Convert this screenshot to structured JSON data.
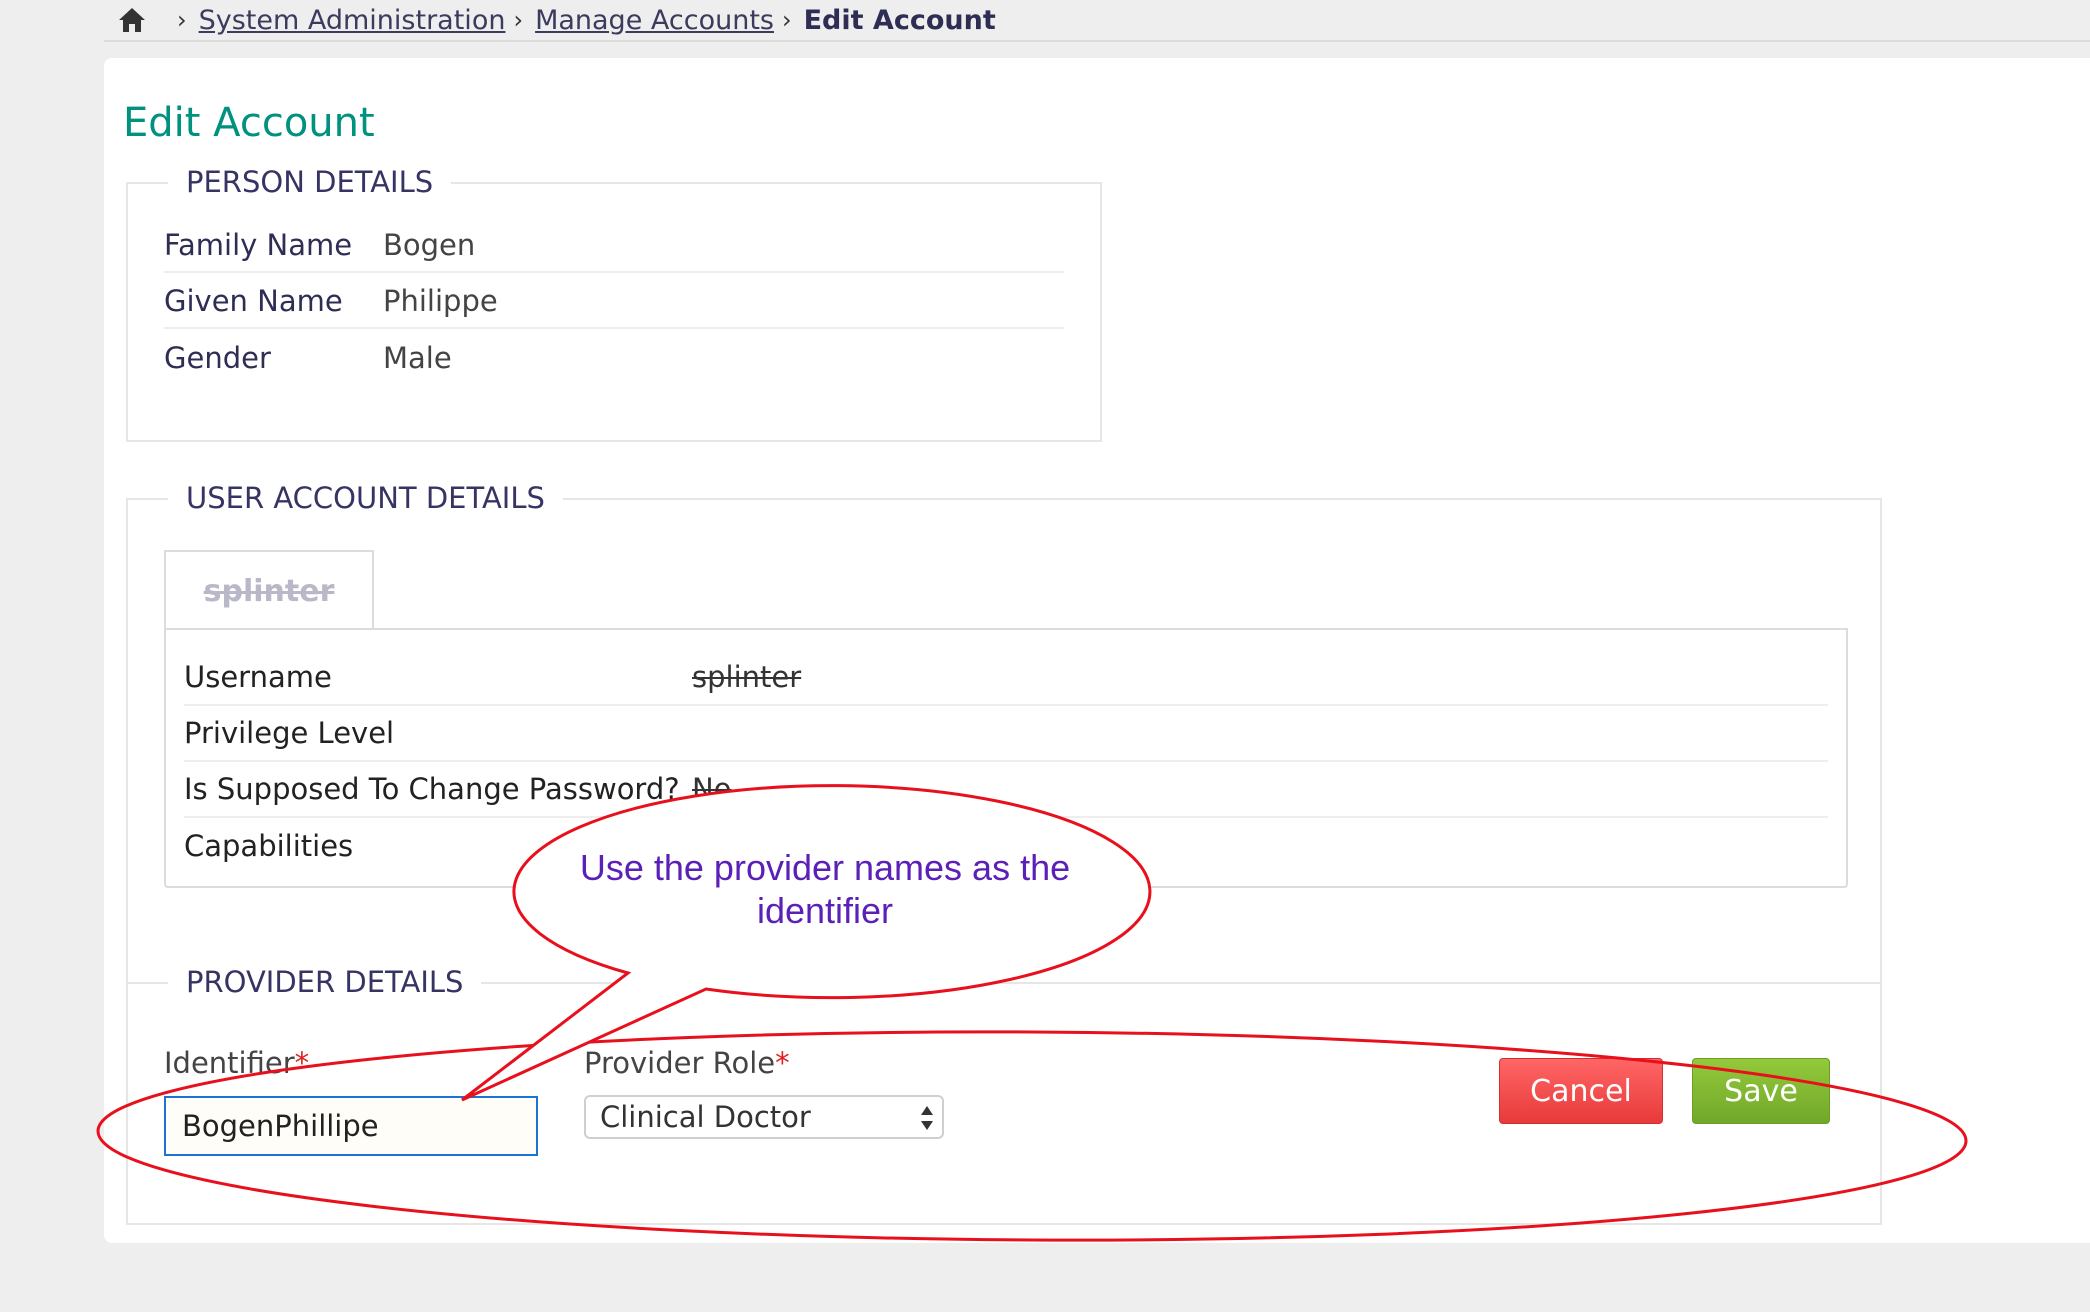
{
  "breadcrumb": {
    "items": [
      "System Administration",
      "Manage Accounts"
    ],
    "current": "Edit Account"
  },
  "page": {
    "title": "Edit Account"
  },
  "person_details": {
    "legend": "PERSON DETAILS",
    "rows": [
      {
        "label": "Family Name",
        "value": "Bogen"
      },
      {
        "label": "Given Name",
        "value": "Philippe"
      },
      {
        "label": "Gender",
        "value": "Male"
      }
    ]
  },
  "user_account_details": {
    "legend": "USER ACCOUNT DETAILS",
    "tab_label": "splinter",
    "rows": [
      {
        "label": "Username",
        "value": "splinter"
      },
      {
        "label": "Privilege Level",
        "value": ""
      },
      {
        "label": "Is Supposed To Change Password?",
        "value": "No"
      },
      {
        "label": "Capabilities",
        "value": ""
      }
    ]
  },
  "provider_details": {
    "legend": "PROVIDER DETAILS",
    "identifier_label": "Identifier",
    "identifier_value": "BogenPhillipe",
    "provider_role_label": "Provider Role",
    "provider_role_value": "Clinical Doctor",
    "required_marker": "*",
    "cancel_label": "Cancel",
    "save_label": "Save"
  },
  "annotation": {
    "text": "Use the provider names as the identifier",
    "color": "#e8101c",
    "text_color": "#5a20b8"
  },
  "colors": {
    "title": "#00917f",
    "cancel": "#ee4444",
    "save": "#7bb32e",
    "focus_border": "#1e73d2"
  }
}
